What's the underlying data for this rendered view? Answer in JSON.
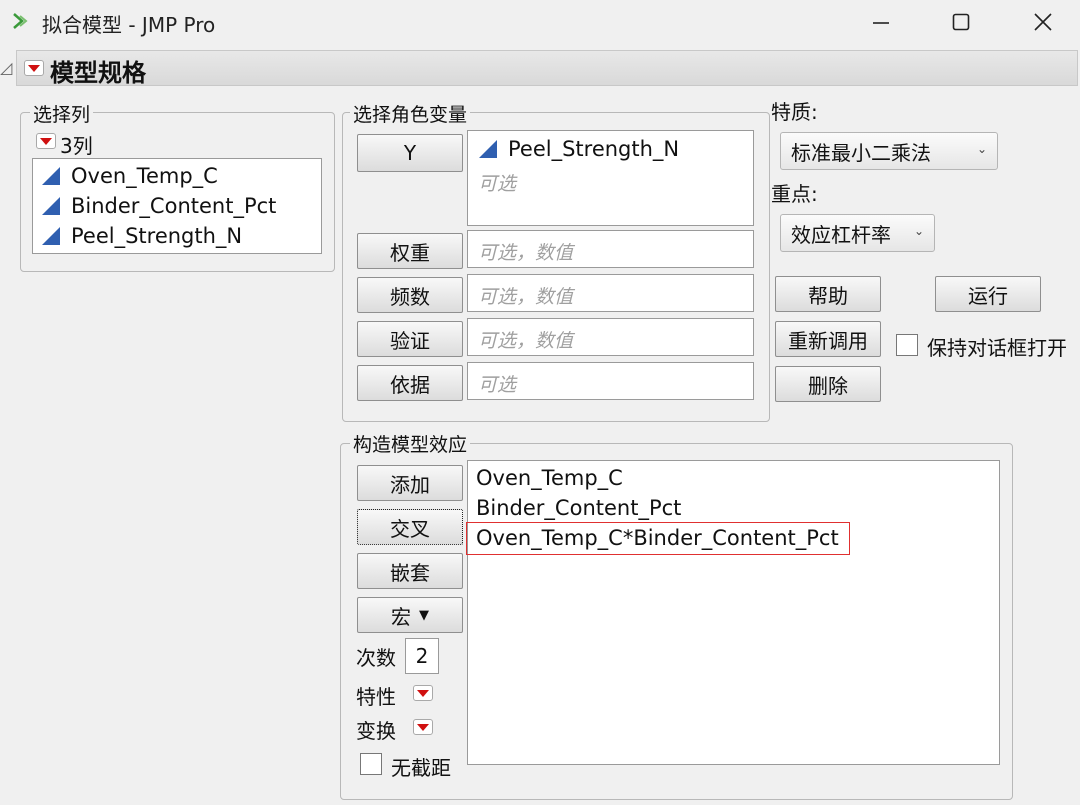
{
  "window": {
    "title": "拟合模型 - JMP Pro",
    "minimize_symbol": "—",
    "maximize_symbol": "☐",
    "close_symbol": "✕"
  },
  "outline": {
    "title": "模型规格"
  },
  "select_columns": {
    "label": "选择列",
    "count_label": "3列",
    "items": [
      "Oven_Temp_C",
      "Binder_Content_Pct",
      "Peel_Strength_N"
    ]
  },
  "roles": {
    "label": "选择角色变量",
    "y_button": "Y",
    "y_value": "Peel_Strength_N",
    "y_placeholder": "可选",
    "rows": [
      {
        "button": "权重",
        "placeholder": "可选，数值"
      },
      {
        "button": "频数",
        "placeholder": "可选，数值"
      },
      {
        "button": "验证",
        "placeholder": "可选，数值"
      },
      {
        "button": "依据",
        "placeholder": "可选"
      }
    ]
  },
  "options": {
    "personality_label": "特质:",
    "personality_value": "标准最小二乘法",
    "emphasis_label": "重点:",
    "emphasis_value": "效应杠杆率",
    "help_button": "帮助",
    "run_button": "运行",
    "recall_button": "重新调用",
    "keep_open_label": "保持对话框打开",
    "remove_button": "删除"
  },
  "construct": {
    "label": "构造模型效应",
    "add_button": "添加",
    "cross_button": "交叉",
    "nest_button": "嵌套",
    "macros_button": "宏",
    "degree_label": "次数",
    "degree_value": "2",
    "attributes_label": "特性",
    "transform_label": "变换",
    "no_intercept_label": "无截距",
    "effects": [
      "Oven_Temp_C",
      "Binder_Content_Pct",
      "Oven_Temp_C*Binder_Content_Pct"
    ],
    "highlight_color": "#e03030"
  },
  "colors": {
    "continuous_icon": "#2f5fb0",
    "red_menu": "#d01010"
  }
}
